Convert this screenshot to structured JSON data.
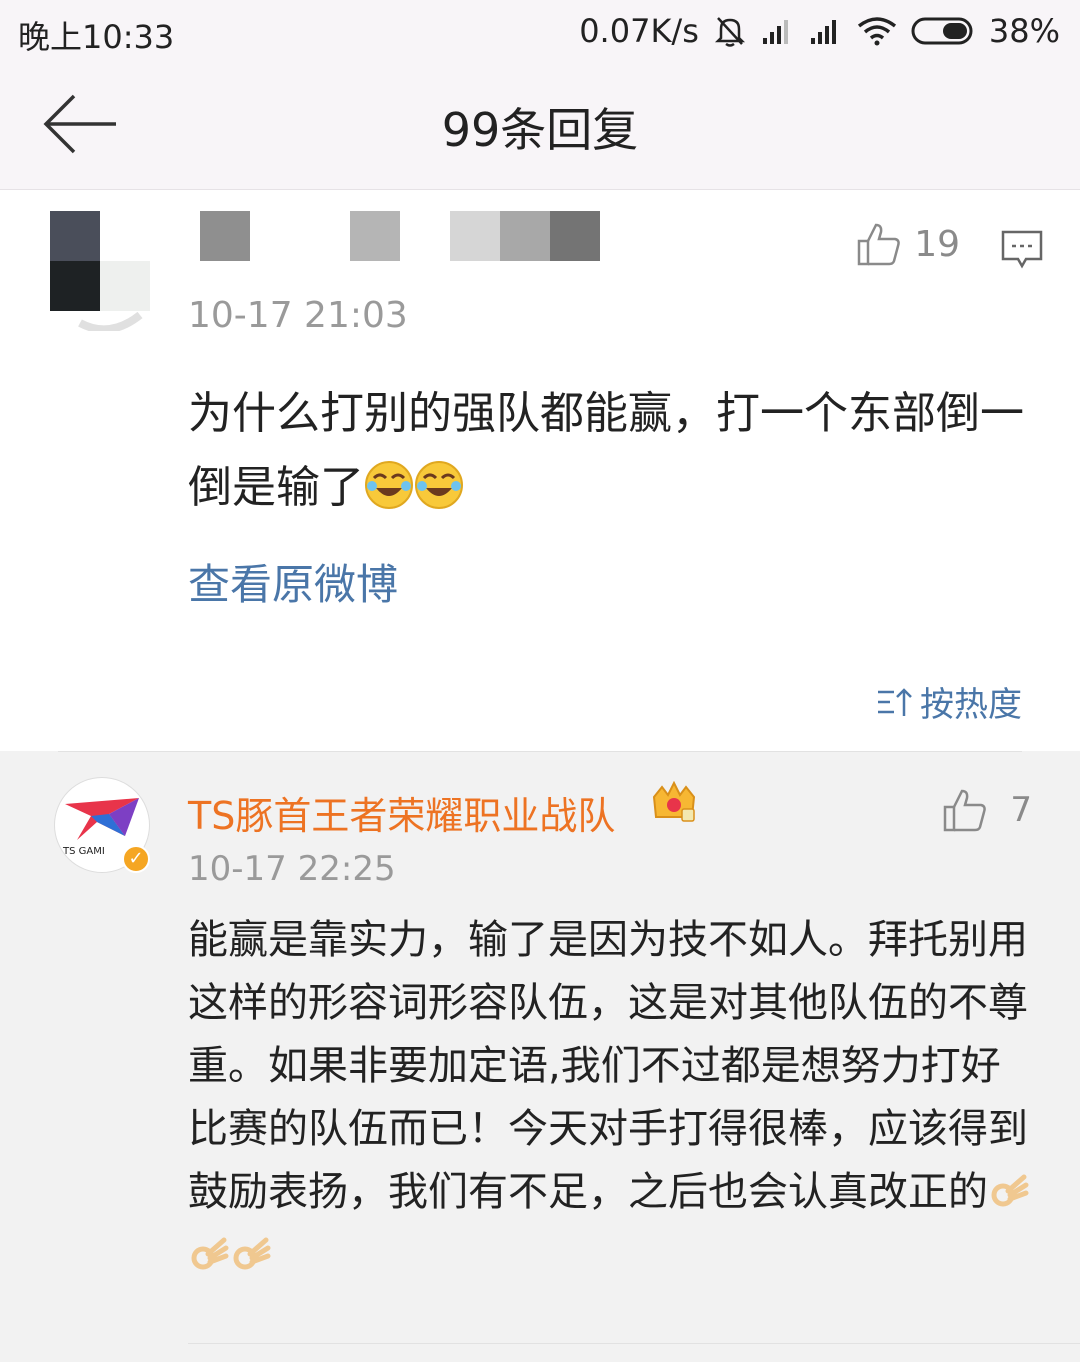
{
  "status_bar": {
    "time": "晚上10:33",
    "network_speed": "0.07K/s",
    "battery": "38%"
  },
  "nav": {
    "title": "99条回复"
  },
  "main_post": {
    "time": "10-17 21:03",
    "likes": "19",
    "text": "为什么打别的强队都能赢，打一个东部倒一倒是输了",
    "view_original": "查看原微博",
    "sort_label": "按热度"
  },
  "reply": {
    "author": "TS豚首王者荣耀职业战队",
    "avatar_text": "TS GAMI",
    "likes": "7",
    "time": "10-17 22:25",
    "text": "能赢是靠实力，输了是因为技不如人。拜托别用这样的形容词形容队伍，这是对其他队伍的不尊重。如果非要加定语,我们不过都是想努力打好比赛的队伍而已！今天对手打得很棒，应该得到鼓励表扬，我们有不足，之后也会认真改正的"
  },
  "colors": {
    "link": "#4a76a8",
    "author": "#ed7323",
    "reply_bg": "#f2f2f2"
  }
}
